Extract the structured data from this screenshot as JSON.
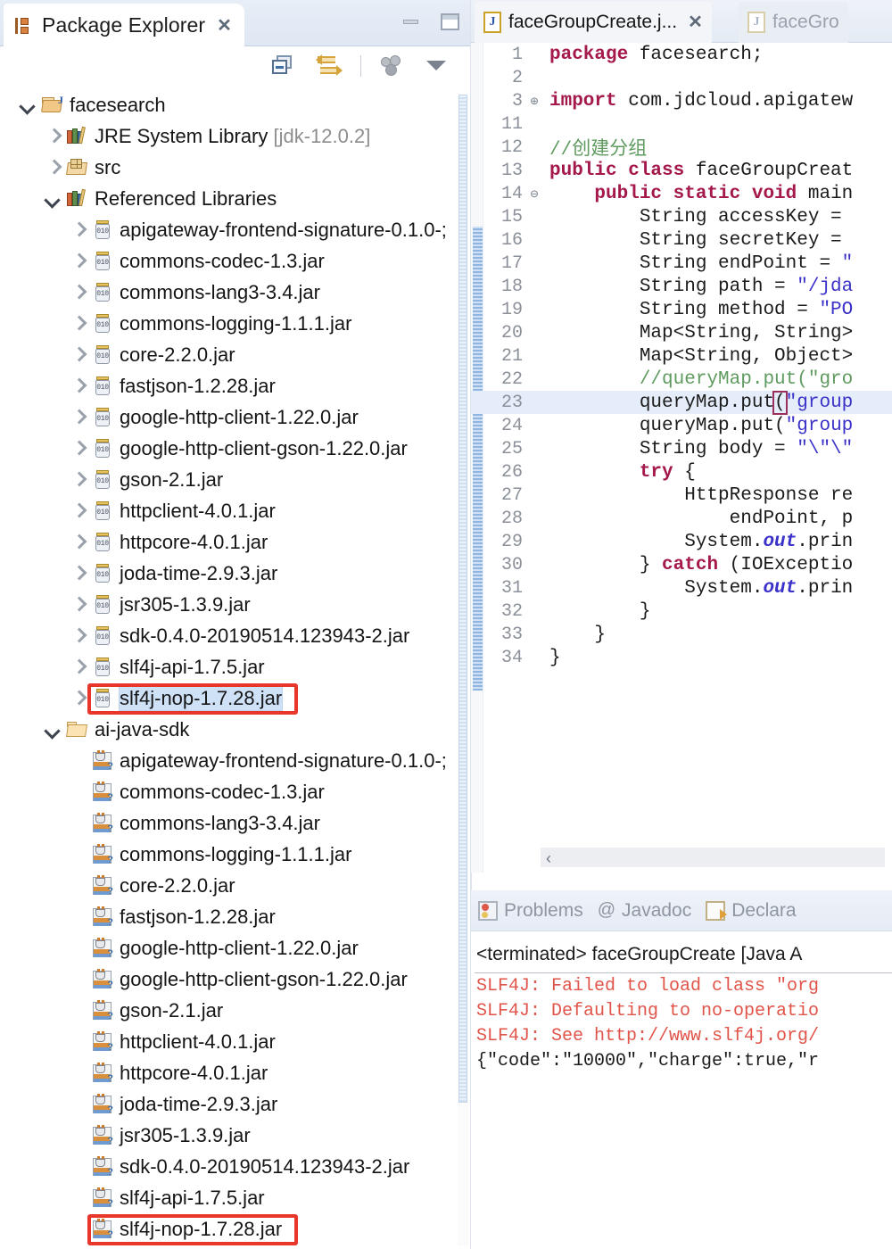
{
  "explorer": {
    "tab": {
      "title": "Package Explorer",
      "close": "✕",
      "icon": "package-explorer-icon"
    },
    "window_buttons": {
      "minimize": "minimize",
      "maximize": "maximize"
    },
    "toolbar": [
      {
        "name": "collapse-all-icon",
        "label": "Collapse All"
      },
      {
        "name": "link-with-editor-icon",
        "label": "Link with Editor"
      },
      {
        "name": "view-menu-dots-icon",
        "label": "View Menu"
      },
      {
        "name": "view-menu-caret-icon",
        "label": "View Menu"
      }
    ],
    "tree": [
      {
        "label": "facesearch",
        "indent": 0,
        "arrow": "open",
        "icon": "project-icon"
      },
      {
        "label": "JRE System Library",
        "suffix": " [jdk-12.0.2]",
        "indent": 1,
        "arrow": "closed",
        "icon": "library-icon"
      },
      {
        "label": "src",
        "indent": 1,
        "arrow": "closed",
        "icon": "source-folder-icon"
      },
      {
        "label": "Referenced Libraries",
        "indent": 1,
        "arrow": "open",
        "icon": "library-icon"
      },
      {
        "label": "apigateway-frontend-signature-0.1.0-;",
        "indent": 2,
        "arrow": "closed",
        "icon": "jar-icon"
      },
      {
        "label": "commons-codec-1.3.jar",
        "indent": 2,
        "arrow": "closed",
        "icon": "jar-icon"
      },
      {
        "label": "commons-lang3-3.4.jar",
        "indent": 2,
        "arrow": "closed",
        "icon": "jar-icon"
      },
      {
        "label": "commons-logging-1.1.1.jar",
        "indent": 2,
        "arrow": "closed",
        "icon": "jar-icon"
      },
      {
        "label": "core-2.2.0.jar",
        "indent": 2,
        "arrow": "closed",
        "icon": "jar-icon"
      },
      {
        "label": "fastjson-1.2.28.jar",
        "indent": 2,
        "arrow": "closed",
        "icon": "jar-icon"
      },
      {
        "label": "google-http-client-1.22.0.jar",
        "indent": 2,
        "arrow": "closed",
        "icon": "jar-icon"
      },
      {
        "label": "google-http-client-gson-1.22.0.jar",
        "indent": 2,
        "arrow": "closed",
        "icon": "jar-icon"
      },
      {
        "label": "gson-2.1.jar",
        "indent": 2,
        "arrow": "closed",
        "icon": "jar-icon"
      },
      {
        "label": "httpclient-4.0.1.jar",
        "indent": 2,
        "arrow": "closed",
        "icon": "jar-icon"
      },
      {
        "label": "httpcore-4.0.1.jar",
        "indent": 2,
        "arrow": "closed",
        "icon": "jar-icon"
      },
      {
        "label": "joda-time-2.9.3.jar",
        "indent": 2,
        "arrow": "closed",
        "icon": "jar-icon"
      },
      {
        "label": "jsr305-1.3.9.jar",
        "indent": 2,
        "arrow": "closed",
        "icon": "jar-icon"
      },
      {
        "label": "sdk-0.4.0-20190514.123943-2.jar",
        "indent": 2,
        "arrow": "closed",
        "icon": "jar-icon"
      },
      {
        "label": "slf4j-api-1.7.5.jar",
        "indent": 2,
        "arrow": "closed",
        "icon": "jar-icon"
      },
      {
        "label": "slf4j-nop-1.7.28.jar",
        "indent": 2,
        "arrow": "closed",
        "icon": "jar-icon",
        "selected": true,
        "highlighted": true
      },
      {
        "label": "ai-java-sdk",
        "indent": 1,
        "arrow": "open",
        "icon": "folder-icon"
      },
      {
        "label": "apigateway-frontend-signature-0.1.0-;",
        "indent": 2,
        "arrow": "none",
        "icon": "java-archive-icon"
      },
      {
        "label": "commons-codec-1.3.jar",
        "indent": 2,
        "arrow": "none",
        "icon": "java-archive-icon"
      },
      {
        "label": "commons-lang3-3.4.jar",
        "indent": 2,
        "arrow": "none",
        "icon": "java-archive-icon"
      },
      {
        "label": "commons-logging-1.1.1.jar",
        "indent": 2,
        "arrow": "none",
        "icon": "java-archive-icon"
      },
      {
        "label": "core-2.2.0.jar",
        "indent": 2,
        "arrow": "none",
        "icon": "java-archive-icon"
      },
      {
        "label": "fastjson-1.2.28.jar",
        "indent": 2,
        "arrow": "none",
        "icon": "java-archive-icon"
      },
      {
        "label": "google-http-client-1.22.0.jar",
        "indent": 2,
        "arrow": "none",
        "icon": "java-archive-icon"
      },
      {
        "label": "google-http-client-gson-1.22.0.jar",
        "indent": 2,
        "arrow": "none",
        "icon": "java-archive-icon"
      },
      {
        "label": "gson-2.1.jar",
        "indent": 2,
        "arrow": "none",
        "icon": "java-archive-icon"
      },
      {
        "label": "httpclient-4.0.1.jar",
        "indent": 2,
        "arrow": "none",
        "icon": "java-archive-icon"
      },
      {
        "label": "httpcore-4.0.1.jar",
        "indent": 2,
        "arrow": "none",
        "icon": "java-archive-icon"
      },
      {
        "label": "joda-time-2.9.3.jar",
        "indent": 2,
        "arrow": "none",
        "icon": "java-archive-icon"
      },
      {
        "label": "jsr305-1.3.9.jar",
        "indent": 2,
        "arrow": "none",
        "icon": "java-archive-icon"
      },
      {
        "label": "sdk-0.4.0-20190514.123943-2.jar",
        "indent": 2,
        "arrow": "none",
        "icon": "java-archive-icon"
      },
      {
        "label": "slf4j-api-1.7.5.jar",
        "indent": 2,
        "arrow": "none",
        "icon": "java-archive-icon"
      },
      {
        "label": "slf4j-nop-1.7.28.jar",
        "indent": 2,
        "arrow": "none",
        "icon": "java-archive-icon",
        "highlighted": true
      }
    ]
  },
  "editor": {
    "tabs": [
      {
        "title": "faceGroupCreate.j...",
        "active": true,
        "close": "✕",
        "icon": "java-file-icon"
      },
      {
        "title": "faceGro",
        "active": false,
        "icon": "java-file-icon"
      }
    ],
    "lines": [
      {
        "n": "1",
        "fold": "",
        "tokens": [
          {
            "t": "package ",
            "c": "kw"
          },
          {
            "t": "facesearch;",
            "c": "pl"
          }
        ]
      },
      {
        "n": "2",
        "fold": "",
        "tokens": []
      },
      {
        "n": "3",
        "fold": "⊕",
        "tokens": [
          {
            "t": "import ",
            "c": "kw"
          },
          {
            "t": "com.jdcloud.apigatew",
            "c": "pl"
          }
        ]
      },
      {
        "n": "11",
        "fold": "",
        "tokens": []
      },
      {
        "n": "12",
        "fold": "",
        "tokens": [
          {
            "t": "//创建分组",
            "c": "cmt"
          }
        ]
      },
      {
        "n": "13",
        "fold": "",
        "tokens": [
          {
            "t": "public class ",
            "c": "kw"
          },
          {
            "t": "faceGroupCreat",
            "c": "pl"
          }
        ]
      },
      {
        "n": "14",
        "fold": "⊖",
        "tokens": [
          {
            "t": "    ",
            "c": "pl"
          },
          {
            "t": "public static void ",
            "c": "kw"
          },
          {
            "t": "main",
            "c": "pl"
          }
        ]
      },
      {
        "n": "15",
        "fold": "",
        "tokens": [
          {
            "t": "        String accessKey = ",
            "c": "pl"
          }
        ]
      },
      {
        "n": "16",
        "fold": "",
        "tokens": [
          {
            "t": "        String secretKey = ",
            "c": "pl"
          }
        ]
      },
      {
        "n": "17",
        "fold": "",
        "tokens": [
          {
            "t": "        String endPoint = ",
            "c": "pl"
          },
          {
            "t": "\"",
            "c": "str"
          }
        ]
      },
      {
        "n": "18",
        "fold": "",
        "tokens": [
          {
            "t": "        String path = ",
            "c": "pl"
          },
          {
            "t": "\"/jda",
            "c": "str"
          }
        ]
      },
      {
        "n": "19",
        "fold": "",
        "tokens": [
          {
            "t": "        String method = ",
            "c": "pl"
          },
          {
            "t": "\"PO",
            "c": "str"
          }
        ]
      },
      {
        "n": "20",
        "fold": "",
        "tokens": [
          {
            "t": "        Map<String, String>",
            "c": "pl"
          }
        ]
      },
      {
        "n": "21",
        "fold": "",
        "tokens": [
          {
            "t": "        Map<String, Object>",
            "c": "pl"
          }
        ]
      },
      {
        "n": "22",
        "fold": "",
        "tokens": [
          {
            "t": "        //queryMap.put(\"gro",
            "c": "cmt"
          }
        ]
      },
      {
        "n": "23",
        "fold": "",
        "cursor": true,
        "tokens": [
          {
            "t": "        queryMap.put",
            "c": "pl"
          },
          {
            "t": "(",
            "c": "pl",
            "brk": true
          },
          {
            "t": "\"group",
            "c": "str"
          }
        ]
      },
      {
        "n": "24",
        "fold": "",
        "tokens": [
          {
            "t": "        queryMap.put(",
            "c": "pl"
          },
          {
            "t": "\"group",
            "c": "str"
          }
        ]
      },
      {
        "n": "25",
        "fold": "",
        "tokens": [
          {
            "t": "        String body = ",
            "c": "pl"
          },
          {
            "t": "\"\\\"\\\"",
            "c": "str"
          }
        ]
      },
      {
        "n": "26",
        "fold": "",
        "tokens": [
          {
            "t": "        ",
            "c": "pl"
          },
          {
            "t": "try",
            "c": "kw"
          },
          {
            "t": " {",
            "c": "pl"
          }
        ]
      },
      {
        "n": "27",
        "fold": "",
        "tokens": [
          {
            "t": "            HttpResponse re",
            "c": "pl"
          }
        ]
      },
      {
        "n": "28",
        "fold": "",
        "tokens": [
          {
            "t": "                endPoint, p",
            "c": "pl"
          }
        ]
      },
      {
        "n": "29",
        "fold": "",
        "tokens": [
          {
            "t": "            System.",
            "c": "pl"
          },
          {
            "t": "out",
            "c": "fld"
          },
          {
            "t": ".prin",
            "c": "pl"
          }
        ]
      },
      {
        "n": "30",
        "fold": "",
        "tokens": [
          {
            "t": "        } ",
            "c": "pl"
          },
          {
            "t": "catch",
            "c": "kw"
          },
          {
            "t": " (IOExceptio",
            "c": "pl"
          }
        ]
      },
      {
        "n": "31",
        "fold": "",
        "tokens": [
          {
            "t": "            System.",
            "c": "pl"
          },
          {
            "t": "out",
            "c": "fld"
          },
          {
            "t": ".prin",
            "c": "pl"
          }
        ]
      },
      {
        "n": "32",
        "fold": "",
        "tokens": [
          {
            "t": "        }",
            "c": "pl"
          }
        ]
      },
      {
        "n": "33",
        "fold": "",
        "tokens": [
          {
            "t": "    }",
            "c": "pl"
          }
        ]
      },
      {
        "n": "34",
        "fold": "",
        "tokens": [
          {
            "t": "}",
            "c": "pl"
          }
        ]
      }
    ],
    "hscroll_arrow": "‹"
  },
  "console": {
    "tabs": [
      {
        "label": "Problems",
        "icon": "problems-icon"
      },
      {
        "label": "Javadoc",
        "icon": "at-icon"
      },
      {
        "label": "Declara",
        "icon": "declaration-icon"
      }
    ],
    "header": "<terminated> faceGroupCreate [Java A",
    "lines": [
      {
        "text": "SLF4J: Failed to load class \"org",
        "kind": "err"
      },
      {
        "text": "SLF4J: Defaulting to no-operatio",
        "kind": "err"
      },
      {
        "text": "SLF4J: See http://www.slf4j.org/",
        "kind": "err"
      },
      {
        "text": "{\"code\":\"10000\",\"charge\":true,\"r",
        "kind": "out"
      }
    ]
  },
  "colors": {
    "selection": "#cfe1f7",
    "annotation": "#e8362a",
    "error_text": "#e0544a",
    "keyword": "#a4184c",
    "string": "#3a31c9",
    "comment": "#5f9a5f"
  }
}
